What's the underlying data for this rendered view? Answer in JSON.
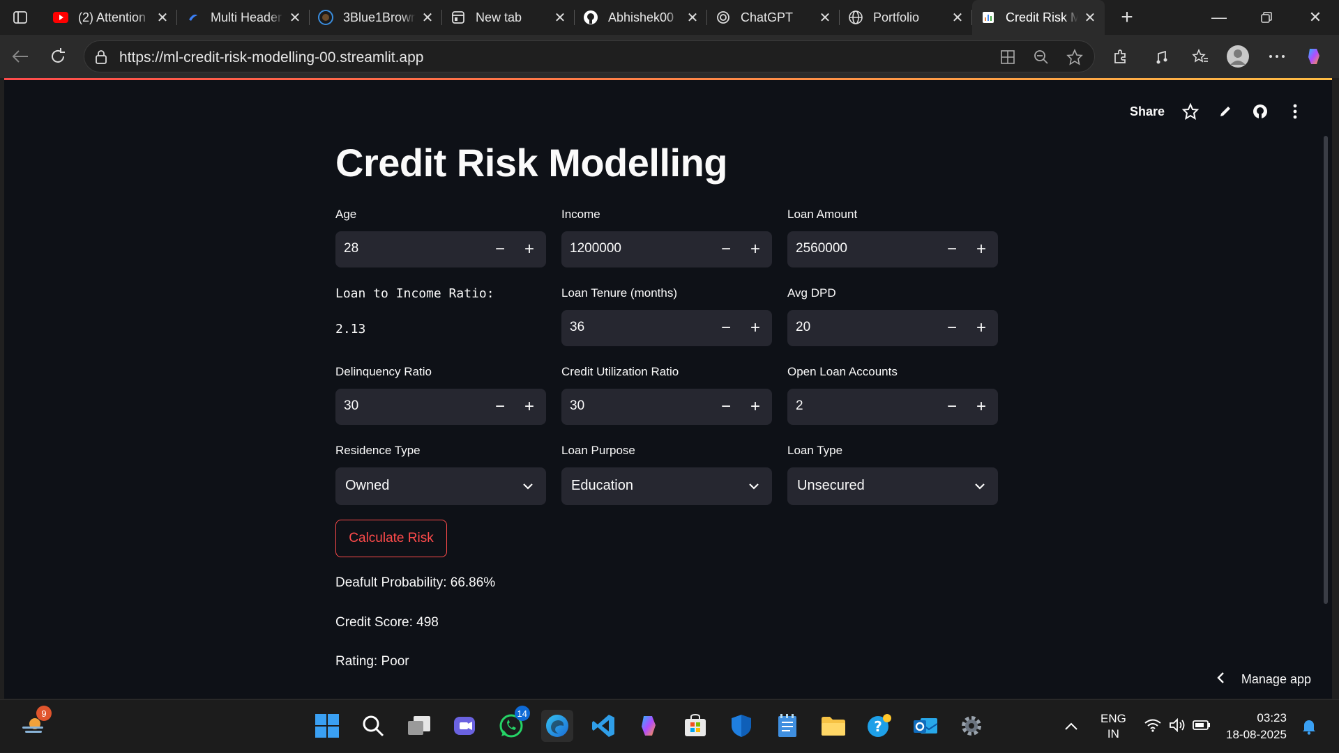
{
  "browser": {
    "tabs": [
      {
        "label": "(2) Attention",
        "icon": "youtube-icon"
      },
      {
        "label": "Multi Header",
        "icon": "site-icon"
      },
      {
        "label": "3Blue1Brown",
        "icon": "3b1b-icon"
      },
      {
        "label": "New tab",
        "icon": "newtab-icon"
      },
      {
        "label": "Abhishek00",
        "icon": "github-icon"
      },
      {
        "label": "ChatGPT",
        "icon": "chatgpt-icon"
      },
      {
        "label": "Portfolio",
        "icon": "globe-icon"
      },
      {
        "label": "Credit Risk M",
        "icon": "streamlit-icon"
      }
    ],
    "url": "https://ml-credit-risk-modelling-00.streamlit.app"
  },
  "header": {
    "share_label": "Share"
  },
  "app": {
    "title": "Credit Risk Modelling",
    "fields": {
      "age": {
        "label": "Age",
        "value": "28"
      },
      "income": {
        "label": "Income",
        "value": "1200000"
      },
      "loan_amount": {
        "label": "Loan Amount",
        "value": "2560000"
      },
      "loan_tenure": {
        "label": "Loan Tenure (months)",
        "value": "36"
      },
      "avg_dpd": {
        "label": "Avg DPD",
        "value": "20"
      },
      "delinquency_ratio": {
        "label": "Delinquency Ratio",
        "value": "30"
      },
      "credit_utilization": {
        "label": "Credit Utilization Ratio",
        "value": "30"
      },
      "open_loan_accounts": {
        "label": "Open Loan Accounts",
        "value": "2"
      }
    },
    "lti": {
      "label": "Loan to Income Ratio:",
      "value": "2.13"
    },
    "selects": {
      "residence_type": {
        "label": "Residence Type",
        "value": "Owned"
      },
      "loan_purpose": {
        "label": "Loan Purpose",
        "value": "Education"
      },
      "loan_type": {
        "label": "Loan Type",
        "value": "Unsecured"
      }
    },
    "calculate_label": "Calculate Risk",
    "results": {
      "probability": "Deafult Probability: 66.86%",
      "credit_score": "Credit Score: 498",
      "rating": "Rating: Poor"
    },
    "manage_label": "Manage app"
  },
  "taskbar": {
    "badges": {
      "app1": "9",
      "whatsapp": "14"
    },
    "lang": {
      "line1": "ENG",
      "line2": "IN"
    },
    "clock": {
      "time": "03:23",
      "date": "18-08-2025"
    }
  },
  "colors": {
    "accent": "#ff4b4b",
    "background": "#0e1117",
    "input_bg": "#262730"
  }
}
